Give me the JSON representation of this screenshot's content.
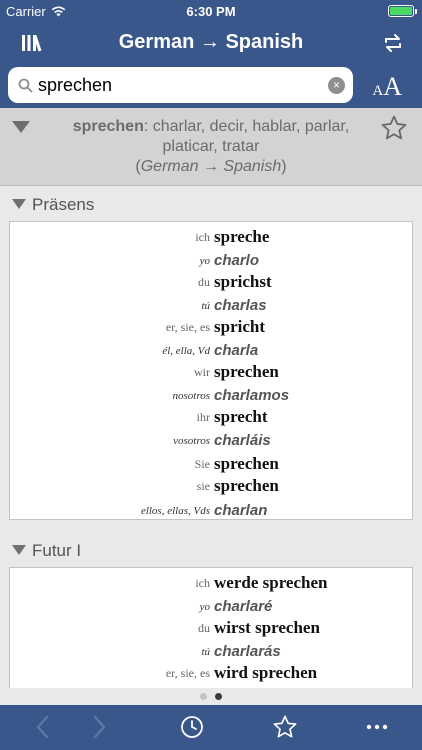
{
  "status": {
    "carrier": "Carrier",
    "time": "6:30 PM"
  },
  "nav": {
    "title": "German → Spanish",
    "library_icon": "library-books-icon",
    "swap_icon": "swap-direction-icon"
  },
  "search": {
    "value": "sprechen",
    "clear_symbol": "×"
  },
  "font_size": {
    "small": "A",
    "big": "A"
  },
  "entry": {
    "headword": "sprechen",
    "colon": ":",
    "translations": " charlar, decir, hablar, parlar, platicar, tratar",
    "direction": "German → Spanish",
    "paren_open": "(",
    "paren_close": ")"
  },
  "sections": [
    {
      "title": "Präsens",
      "rows": [
        {
          "pronoun": "ich",
          "verb": "spreche",
          "lang": "de"
        },
        {
          "pronoun": "yo",
          "verb": "charlo",
          "lang": "es"
        },
        {
          "pronoun": "du",
          "verb": "sprichst",
          "lang": "de"
        },
        {
          "pronoun": "tú",
          "verb": "charlas",
          "lang": "es"
        },
        {
          "pronoun": "er, sie, es",
          "verb": "spricht",
          "lang": "de"
        },
        {
          "pronoun": "él, ella, Vd",
          "verb": "charla",
          "lang": "es"
        },
        {
          "pronoun": "wir",
          "verb": "sprechen",
          "lang": "de"
        },
        {
          "pronoun": "nosotros",
          "verb": "charlamos",
          "lang": "es"
        },
        {
          "pronoun": "ihr",
          "verb": "sprecht",
          "lang": "de"
        },
        {
          "pronoun": "vosotros",
          "verb": "charláis",
          "lang": "es"
        },
        {
          "pronoun": "Sie",
          "verb": "sprechen",
          "lang": "de"
        },
        {
          "pronoun": "sie",
          "verb": "sprechen",
          "lang": "de"
        },
        {
          "pronoun": "ellos, ellas, Vds",
          "verb": "charlan",
          "lang": "es"
        }
      ]
    },
    {
      "title": "Futur I",
      "rows": [
        {
          "pronoun": "ich",
          "verb": "werde sprechen",
          "lang": "de"
        },
        {
          "pronoun": "yo",
          "verb": "charlaré",
          "lang": "es"
        },
        {
          "pronoun": "du",
          "verb": "wirst sprechen",
          "lang": "de"
        },
        {
          "pronoun": "tú",
          "verb": "charlarás",
          "lang": "es"
        },
        {
          "pronoun": "er, sie, es",
          "verb": "wird sprechen",
          "lang": "de"
        }
      ]
    }
  ],
  "pager": {
    "count": 2,
    "active": 2
  },
  "toolbar": {
    "back_icon": "chevron-left-icon",
    "forward_icon": "chevron-right-icon",
    "history_icon": "clock-icon",
    "favorites_icon": "star-icon",
    "more_icon": "more-dots-icon"
  },
  "colors": {
    "bar": "#39578b",
    "header_bg": "#d3d3d3",
    "page_bg": "#e9e9e9",
    "battery": "#4cd964"
  }
}
